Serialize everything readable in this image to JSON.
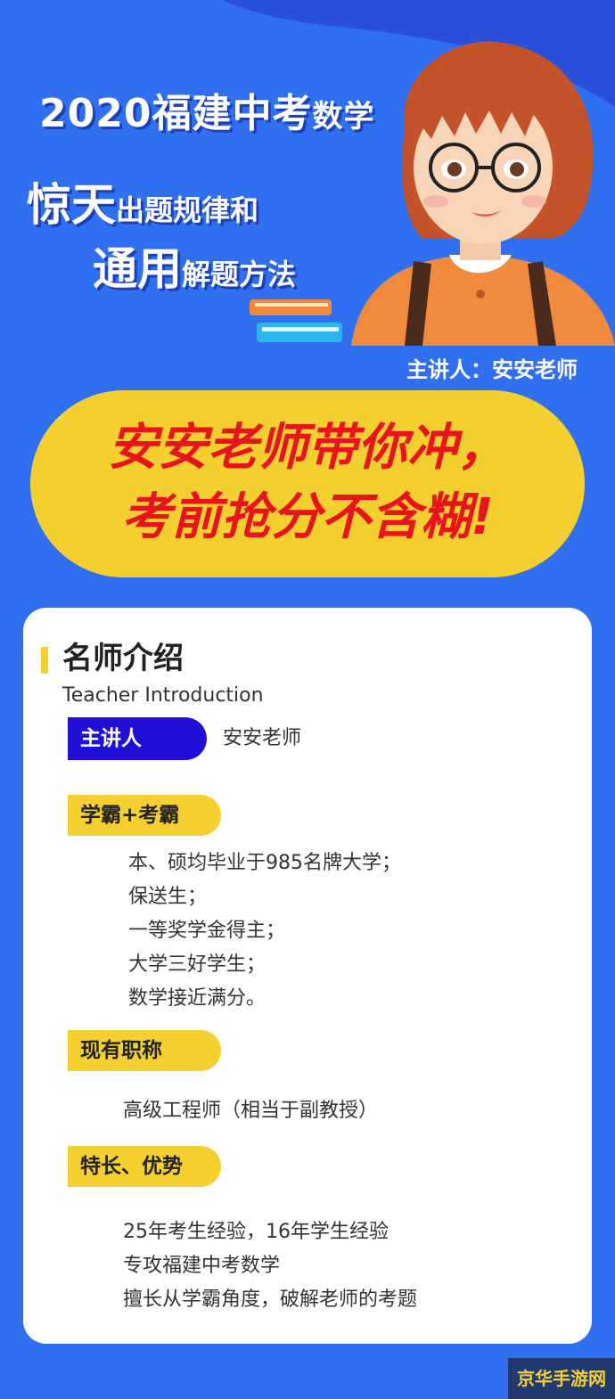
{
  "header": {
    "year": "2020",
    "title_big": "福建中考",
    "title_small": "数学",
    "line2_big": "惊天",
    "line2_small": "出题规律和",
    "line3_big": "通用",
    "line3_small": "解题方法",
    "presenter_line": "主讲人：安安老师"
  },
  "slogan": {
    "line1": "安安老师带你冲，",
    "line2": "考前抢分不含糊!"
  },
  "card": {
    "title": "名师介绍",
    "subtitle": "Teacher  Introduction",
    "presenter_tag": "主讲人",
    "presenter_name": "安安老师",
    "sections": [
      {
        "tag": "学霸+考霸",
        "lines": [
          "本、硕均毕业于985名牌大学；",
          "保送生；",
          "一等奖学金得主；",
          "大学三好学生；",
          "数学接近满分。"
        ]
      },
      {
        "tag": "现有职称",
        "lines": [
          "高级工程师（相当于副教授）"
        ]
      },
      {
        "tag": "特长、优势",
        "lines": [
          "25年考生经验，16年学生经验",
          "专攻福建中考数学",
          "擅长从学霸角度，破解老师的考题"
        ]
      }
    ]
  },
  "watermark": "京华手游网",
  "colors": {
    "background": "#2f6ff0",
    "accent_yellow": "#f4cf30",
    "slogan_red": "#e8141c",
    "tag_blue": "#2010d6"
  }
}
